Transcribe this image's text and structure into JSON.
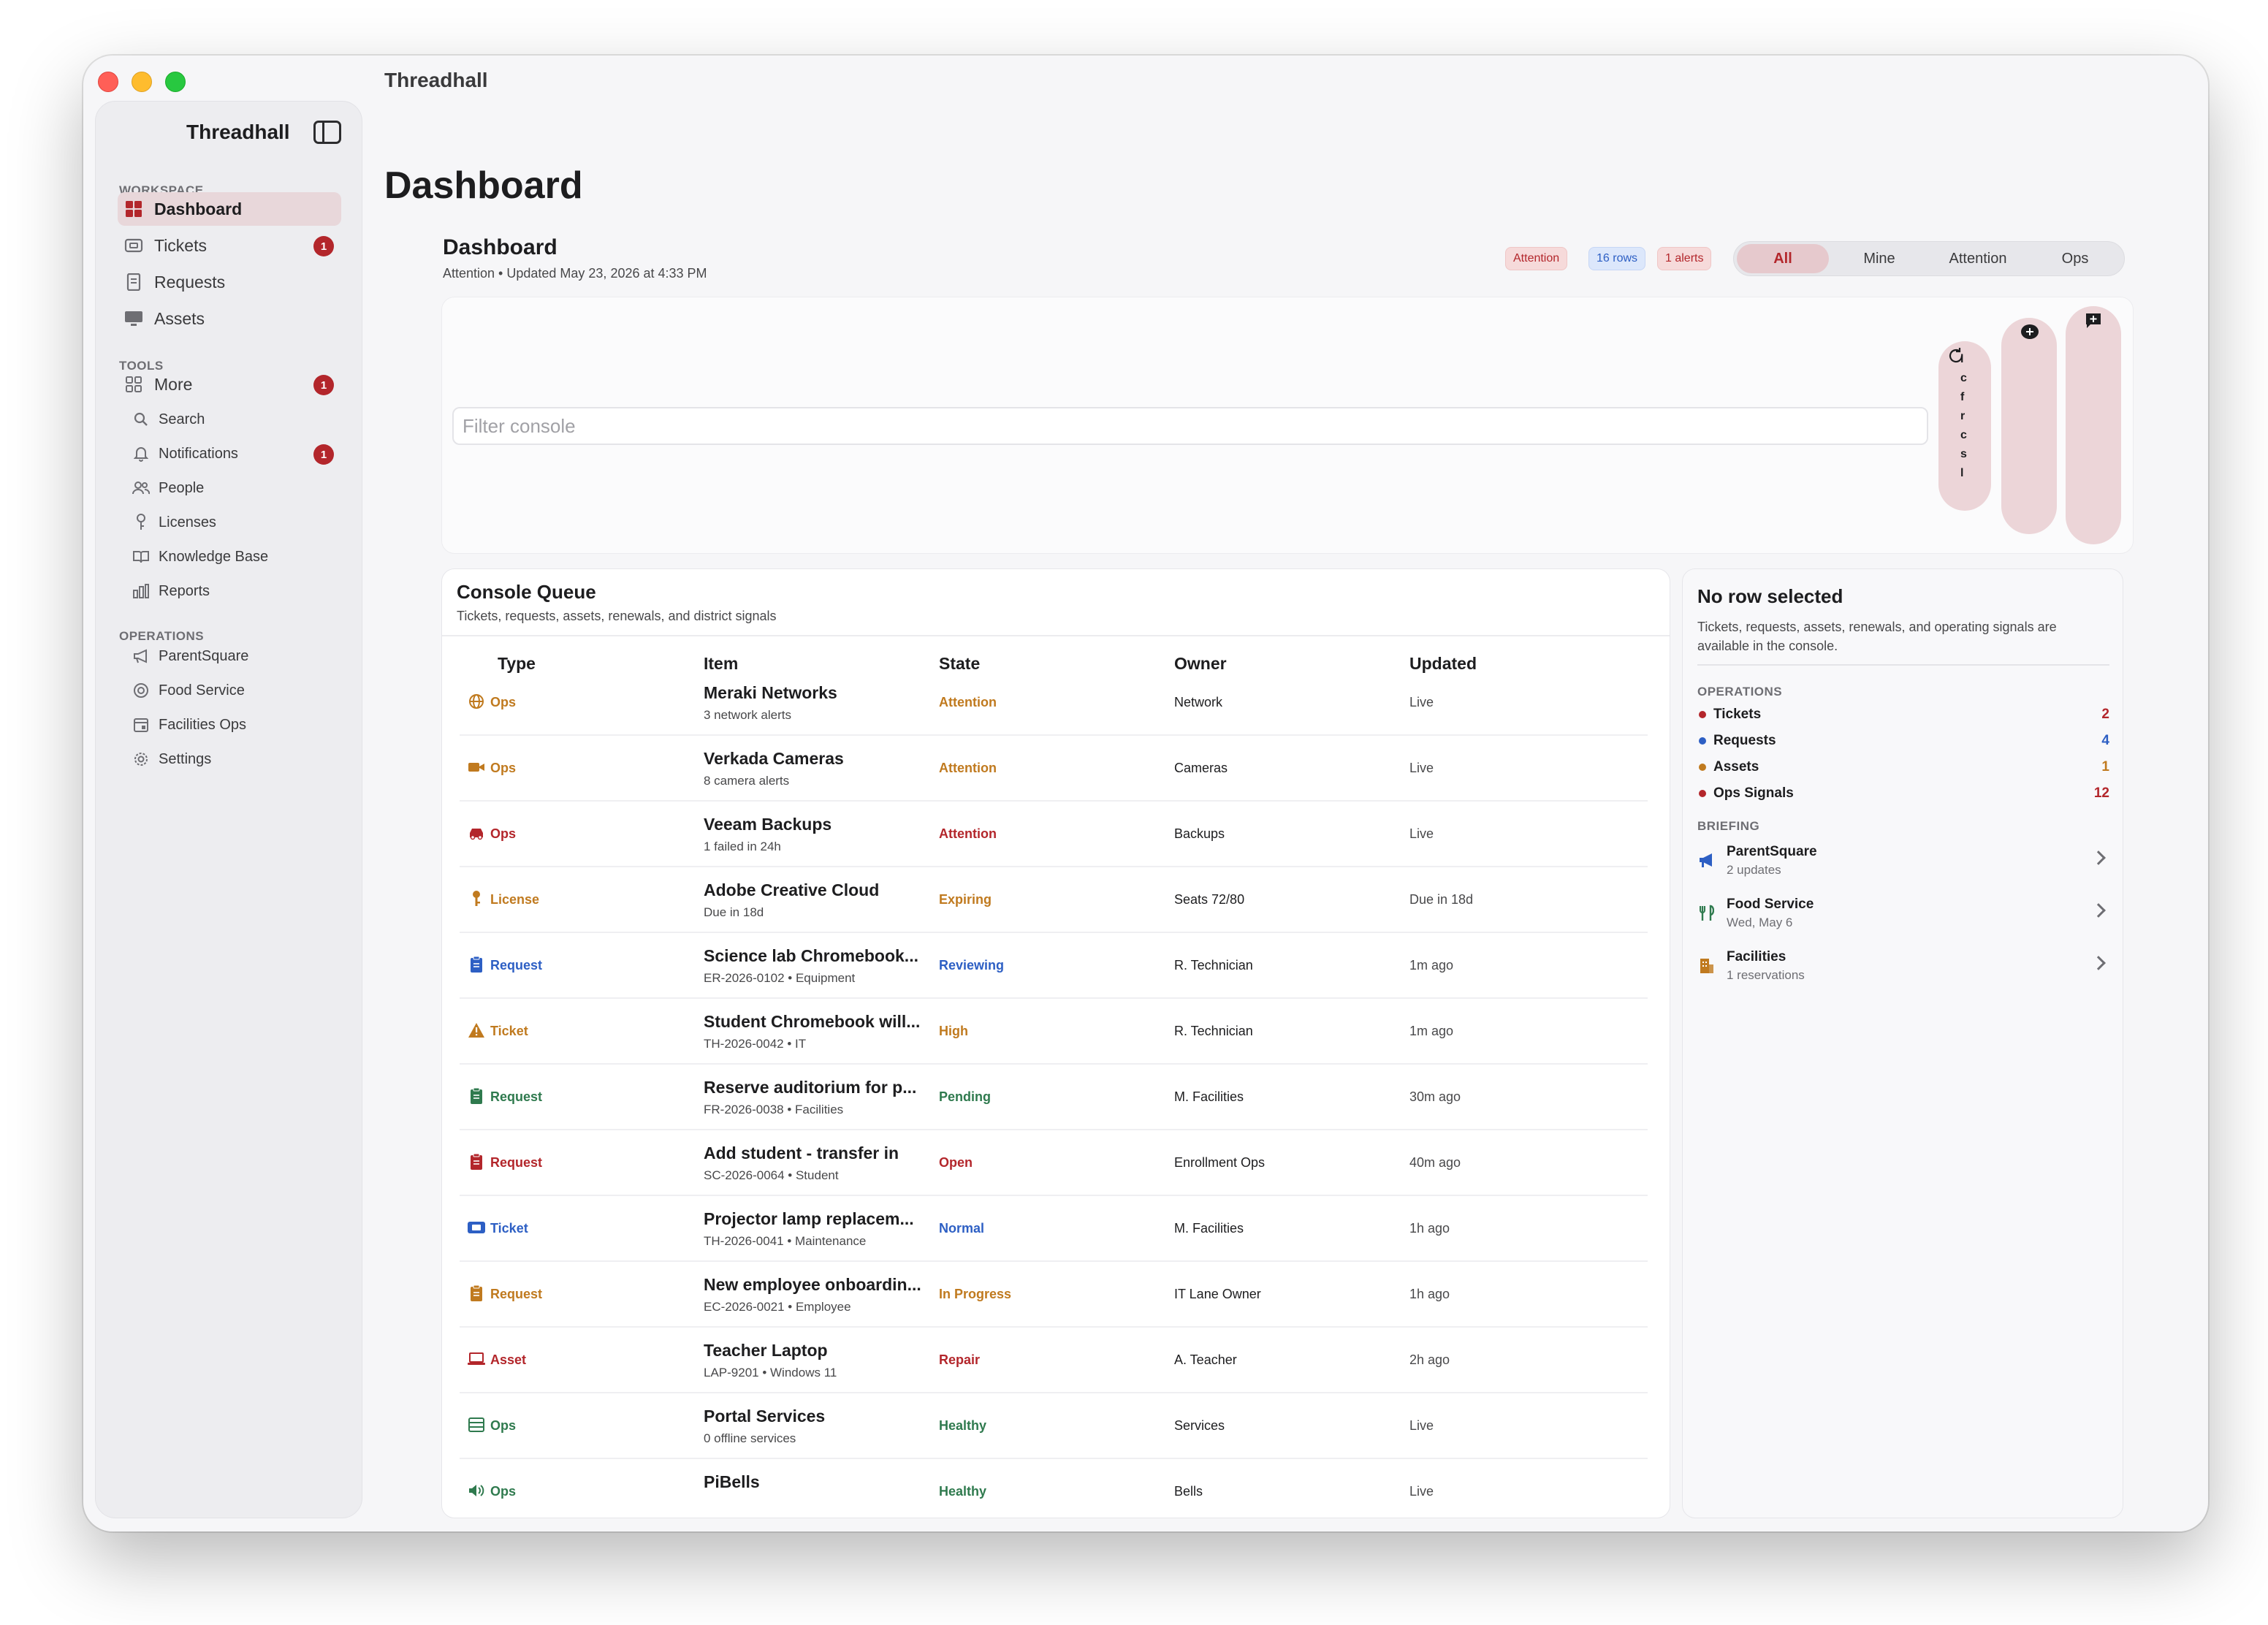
{
  "window": {
    "title": "Threadhall"
  },
  "sidebar": {
    "app_name": "Threadhall",
    "sections": {
      "workspace": "WORKSPACE",
      "tools": "TOOLS",
      "operations": "OPERATIONS"
    },
    "workspace_items": [
      {
        "label": "Dashboard",
        "icon": "dashboard-grid-icon",
        "active": true
      },
      {
        "label": "Tickets",
        "icon": "ticket-icon",
        "badge": "1"
      },
      {
        "label": "Requests",
        "icon": "document-icon"
      },
      {
        "label": "Assets",
        "icon": "monitor-icon"
      }
    ],
    "tools_more": {
      "label": "More",
      "icon": "grid-icon",
      "badge": "1"
    },
    "tools_items": [
      {
        "label": "Search",
        "icon": "search-icon"
      },
      {
        "label": "Notifications",
        "icon": "bell-icon",
        "badge": "1"
      },
      {
        "label": "People",
        "icon": "people-icon"
      },
      {
        "label": "Licenses",
        "icon": "key-icon"
      },
      {
        "label": "Knowledge Base",
        "icon": "book-icon"
      },
      {
        "label": "Reports",
        "icon": "bar-chart-icon"
      }
    ],
    "operations_items": [
      {
        "label": "ParentSquare",
        "icon": "megaphone-icon"
      },
      {
        "label": "Food Service",
        "icon": "food-icon"
      },
      {
        "label": "Facilities Ops",
        "icon": "calendar-icon"
      },
      {
        "label": "Settings",
        "icon": "gear-icon"
      }
    ]
  },
  "main": {
    "page_title": "Dashboard",
    "header_title": "Dashboard",
    "header_meta": "Attention • Updated May 23, 2026 at 4:33 PM",
    "pills": {
      "attention": "Attention",
      "rows": "16 rows",
      "alerts": "1 alerts"
    },
    "segments": [
      "All",
      "Mine",
      "Attention",
      "Ops"
    ],
    "filter_placeholder": "Filter console",
    "action_pill_letters": "lcfrcsl"
  },
  "queue": {
    "title": "Console Queue",
    "subtitle": "Tickets, requests, assets, renewals, and district signals",
    "columns": [
      "Type",
      "Item",
      "State",
      "Owner",
      "Updated"
    ],
    "rows": [
      {
        "type": "Ops",
        "type_icon": "network-globe-icon",
        "item": "Meraki Networks",
        "meta": "3 network alerts",
        "state": "Attention",
        "owner": "Network",
        "updated": "Live",
        "tone": "orange",
        "state_tone": "orange"
      },
      {
        "type": "Ops",
        "type_icon": "camera-icon",
        "item": "Verkada Cameras",
        "meta": "8 camera alerts",
        "state": "Attention",
        "owner": "Cameras",
        "updated": "Live",
        "tone": "orange",
        "state_tone": "orange"
      },
      {
        "type": "Ops",
        "type_icon": "backup-car-icon",
        "item": "Veeam Backups",
        "meta": "1 failed in 24h",
        "state": "Attention",
        "owner": "Backups",
        "updated": "Live",
        "tone": "red",
        "state_tone": "red"
      },
      {
        "type": "License",
        "type_icon": "key-icon",
        "item": "Adobe Creative Cloud",
        "meta": "Due in 18d",
        "state": "Expiring",
        "owner": "Seats 72/80",
        "updated": "Due in 18d",
        "tone": "orange",
        "state_tone": "orange"
      },
      {
        "type": "Request",
        "type_icon": "clipboard-icon",
        "item": "Science lab Chromebook...",
        "meta": "ER-2026-0102 • Equipment",
        "state": "Reviewing",
        "owner": "R. Technician",
        "updated": "1m ago",
        "tone": "blue",
        "state_tone": "blue"
      },
      {
        "type": "Ticket",
        "type_icon": "warning-icon",
        "item": "Student Chromebook will...",
        "meta": "TH-2026-0042 • IT",
        "state": "High",
        "owner": "R. Technician",
        "updated": "1m ago",
        "tone": "orange",
        "state_tone": "orange"
      },
      {
        "type": "Request",
        "type_icon": "clipboard-icon",
        "item": "Reserve auditorium for p...",
        "meta": "FR-2026-0038 • Facilities",
        "state": "Pending",
        "owner": "M. Facilities",
        "updated": "30m ago",
        "tone": "green",
        "state_tone": "green"
      },
      {
        "type": "Request",
        "type_icon": "clipboard-icon",
        "item": "Add student - transfer in",
        "meta": "SC-2026-0064 • Student",
        "state": "Open",
        "owner": "Enrollment Ops",
        "updated": "40m ago",
        "tone": "red",
        "state_tone": "red"
      },
      {
        "type": "Ticket",
        "type_icon": "ticket-icon",
        "item": "Projector lamp replacem...",
        "meta": "TH-2026-0041 • Maintenance",
        "state": "Normal",
        "owner": "M. Facilities",
        "updated": "1h ago",
        "tone": "blue",
        "state_tone": "blue"
      },
      {
        "type": "Request",
        "type_icon": "clipboard-icon",
        "item": "New employee onboardin...",
        "meta": "EC-2026-0021 • Employee",
        "state": "In Progress",
        "owner": "IT Lane Owner",
        "updated": "1h ago",
        "tone": "orange",
        "state_tone": "orange"
      },
      {
        "type": "Asset",
        "type_icon": "laptop-icon",
        "item": "Teacher Laptop",
        "meta": "LAP-9201 • Windows 11",
        "state": "Repair",
        "owner": "A. Teacher",
        "updated": "2h ago",
        "tone": "red",
        "state_tone": "red"
      },
      {
        "type": "Ops",
        "type_icon": "server-icon",
        "item": "Portal Services",
        "meta": "0 offline services",
        "state": "Healthy",
        "owner": "Services",
        "updated": "Live",
        "tone": "green",
        "state_tone": "green"
      },
      {
        "type": "Ops",
        "type_icon": "speaker-icon",
        "item": "PiBells",
        "meta": "",
        "state": "Healthy",
        "owner": "Bells",
        "updated": "Live",
        "tone": "green",
        "state_tone": "green"
      }
    ]
  },
  "detail": {
    "title": "No row selected",
    "subtitle": "Tickets, requests, assets, renewals, and operating signals are available in the console.",
    "operations_label": "OPERATIONS",
    "operations": [
      {
        "label": "Tickets",
        "value": "2",
        "color": "#b3262b"
      },
      {
        "label": "Requests",
        "value": "4",
        "color": "#2d5fc4"
      },
      {
        "label": "Assets",
        "value": "1",
        "color": "#c07a1f"
      },
      {
        "label": "Ops Signals",
        "value": "12",
        "color": "#b3262b"
      }
    ],
    "briefing_label": "BRIEFING",
    "briefing": [
      {
        "title": "ParentSquare",
        "subtitle": "2 updates",
        "icon": "megaphone-icon"
      },
      {
        "title": "Food Service",
        "subtitle": "Wed, May 6",
        "icon": "food-icon"
      },
      {
        "title": "Facilities",
        "subtitle": "1 reservations",
        "icon": "building-icon"
      }
    ]
  },
  "colors": {
    "accent": "#b3262b",
    "blue": "#2d5fc4",
    "orange": "#c07a1f",
    "green": "#2f7a4e"
  }
}
